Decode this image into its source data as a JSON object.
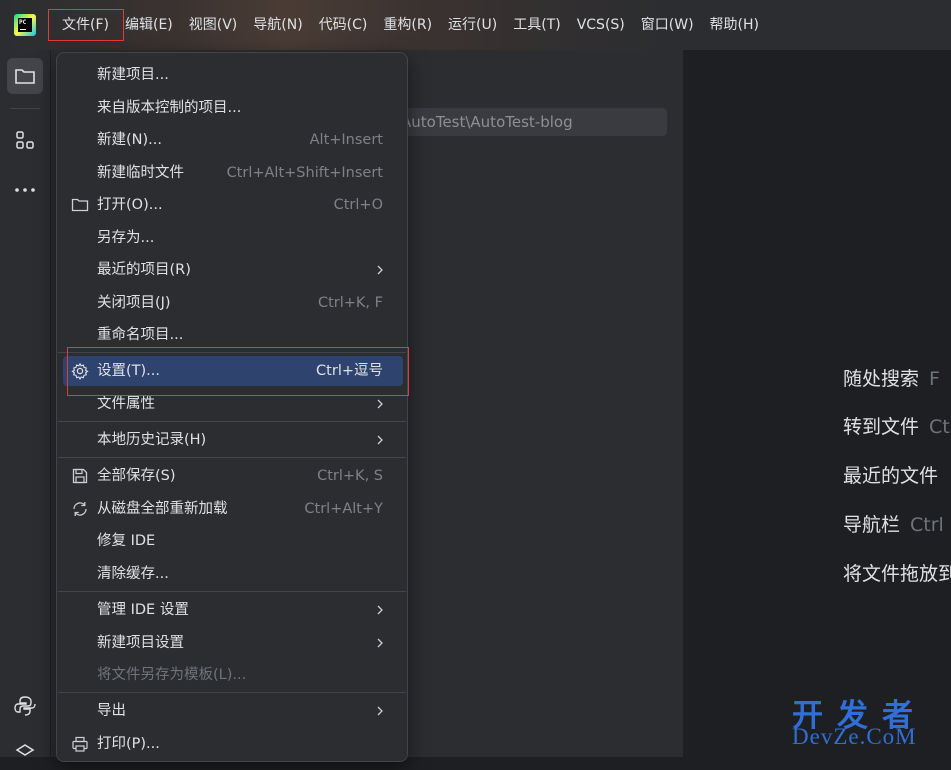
{
  "logo": {
    "text": "PC"
  },
  "menubar": {
    "items": [
      {
        "label": "文件(F)"
      },
      {
        "label": "编辑(E)"
      },
      {
        "label": "视图(V)"
      },
      {
        "label": "导航(N)"
      },
      {
        "label": "代码(C)"
      },
      {
        "label": "重构(R)"
      },
      {
        "label": "运行(U)"
      },
      {
        "label": "工具(T)"
      },
      {
        "label": "VCS(S)"
      },
      {
        "label": "窗口(W)"
      },
      {
        "label": "帮助(H)"
      }
    ]
  },
  "stripe": {
    "icons": [
      "folder-icon",
      "structure-icon",
      "more-icon",
      "python-icon",
      "layers-icon"
    ]
  },
  "path_field": {
    "text": "AutoTest\\AutoTest-blog"
  },
  "hints": [
    {
      "label": "随处搜索",
      "key": "F"
    },
    {
      "label": "转到文件",
      "key": "Ct"
    },
    {
      "label": "最近的文件",
      "key": ""
    },
    {
      "label": "导航栏",
      "key": "Ctrl"
    },
    {
      "label": "将文件拖放到",
      "key": ""
    }
  ],
  "file_menu": {
    "items": [
      {
        "label": "新建项目...",
        "shortcut": ""
      },
      {
        "label": "来自版本控制的项目...",
        "shortcut": ""
      },
      {
        "label": "新建(N)...",
        "shortcut": "Alt+Insert"
      },
      {
        "label": "新建临时文件",
        "shortcut": "Ctrl+Alt+Shift+Insert"
      },
      {
        "label": "打开(O)...",
        "shortcut": "Ctrl+O",
        "icon": "folder-icon"
      },
      {
        "label": "另存为...",
        "shortcut": ""
      },
      {
        "label": "最近的项目(R)",
        "shortcut": "",
        "submenu": true
      },
      {
        "label": "关闭项目(J)",
        "shortcut": "Ctrl+K, F"
      },
      {
        "label": "重命名项目...",
        "shortcut": ""
      },
      {
        "label": "设置(T)...",
        "shortcut": "Ctrl+逗号",
        "icon": "gear-icon",
        "highlighted": true
      },
      {
        "label": "文件属性",
        "shortcut": "",
        "submenu": true
      },
      {
        "label": "本地历史记录(H)",
        "shortcut": "",
        "submenu": true
      },
      {
        "label": "全部保存(S)",
        "shortcut": "Ctrl+K, S",
        "icon": "save-icon"
      },
      {
        "label": "从磁盘全部重新加载",
        "shortcut": "Ctrl+Alt+Y",
        "icon": "reload-icon"
      },
      {
        "label": "修复 IDE",
        "shortcut": ""
      },
      {
        "label": "清除缓存...",
        "shortcut": ""
      },
      {
        "label": "管理 IDE 设置",
        "shortcut": "",
        "submenu": true
      },
      {
        "label": "新建项目设置",
        "shortcut": "",
        "submenu": true
      },
      {
        "label": "将文件另存为模板(L)...",
        "shortcut": "",
        "disabled": true
      },
      {
        "label": "导出",
        "shortcut": "",
        "submenu": true
      },
      {
        "label": "打印(P)...",
        "shortcut": "",
        "icon": "print-icon"
      }
    ]
  },
  "watermark": {
    "top": "开发者",
    "bottom": "DevZe.CoM"
  }
}
